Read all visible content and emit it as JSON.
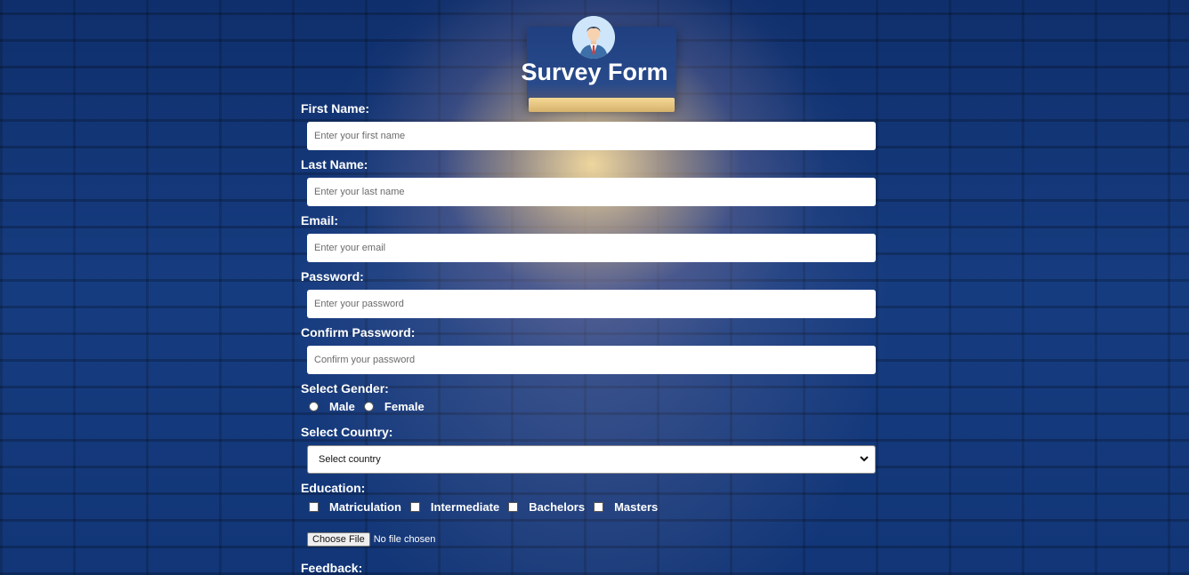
{
  "form": {
    "title": "Survey Form",
    "avatar_icon": "user-avatar-icon",
    "first_name": {
      "label": "First Name:",
      "placeholder": "Enter your first name"
    },
    "last_name": {
      "label": "Last Name:",
      "placeholder": "Enter your last name"
    },
    "email": {
      "label": "Email:",
      "placeholder": "Enter your email"
    },
    "password": {
      "label": "Password:",
      "placeholder": "Enter your password"
    },
    "confirm_password": {
      "label": "Confirm Password:",
      "placeholder": "Confirm your password"
    },
    "gender": {
      "label": "Select Gender:",
      "options": [
        "Male",
        "Female"
      ]
    },
    "country": {
      "label": "Select Country:",
      "selected": "Select country"
    },
    "education": {
      "label": "Education:",
      "options": [
        "Matriculation",
        "Intermediate",
        "Bachelors",
        "Masters"
      ]
    },
    "file": {
      "button_label": "Choose File",
      "status": "No file chosen"
    },
    "feedback": {
      "label": "Feedback:"
    }
  },
  "colors": {
    "background": "#0d2a63",
    "text": "#ffffff",
    "input_background": "#ffffff"
  }
}
